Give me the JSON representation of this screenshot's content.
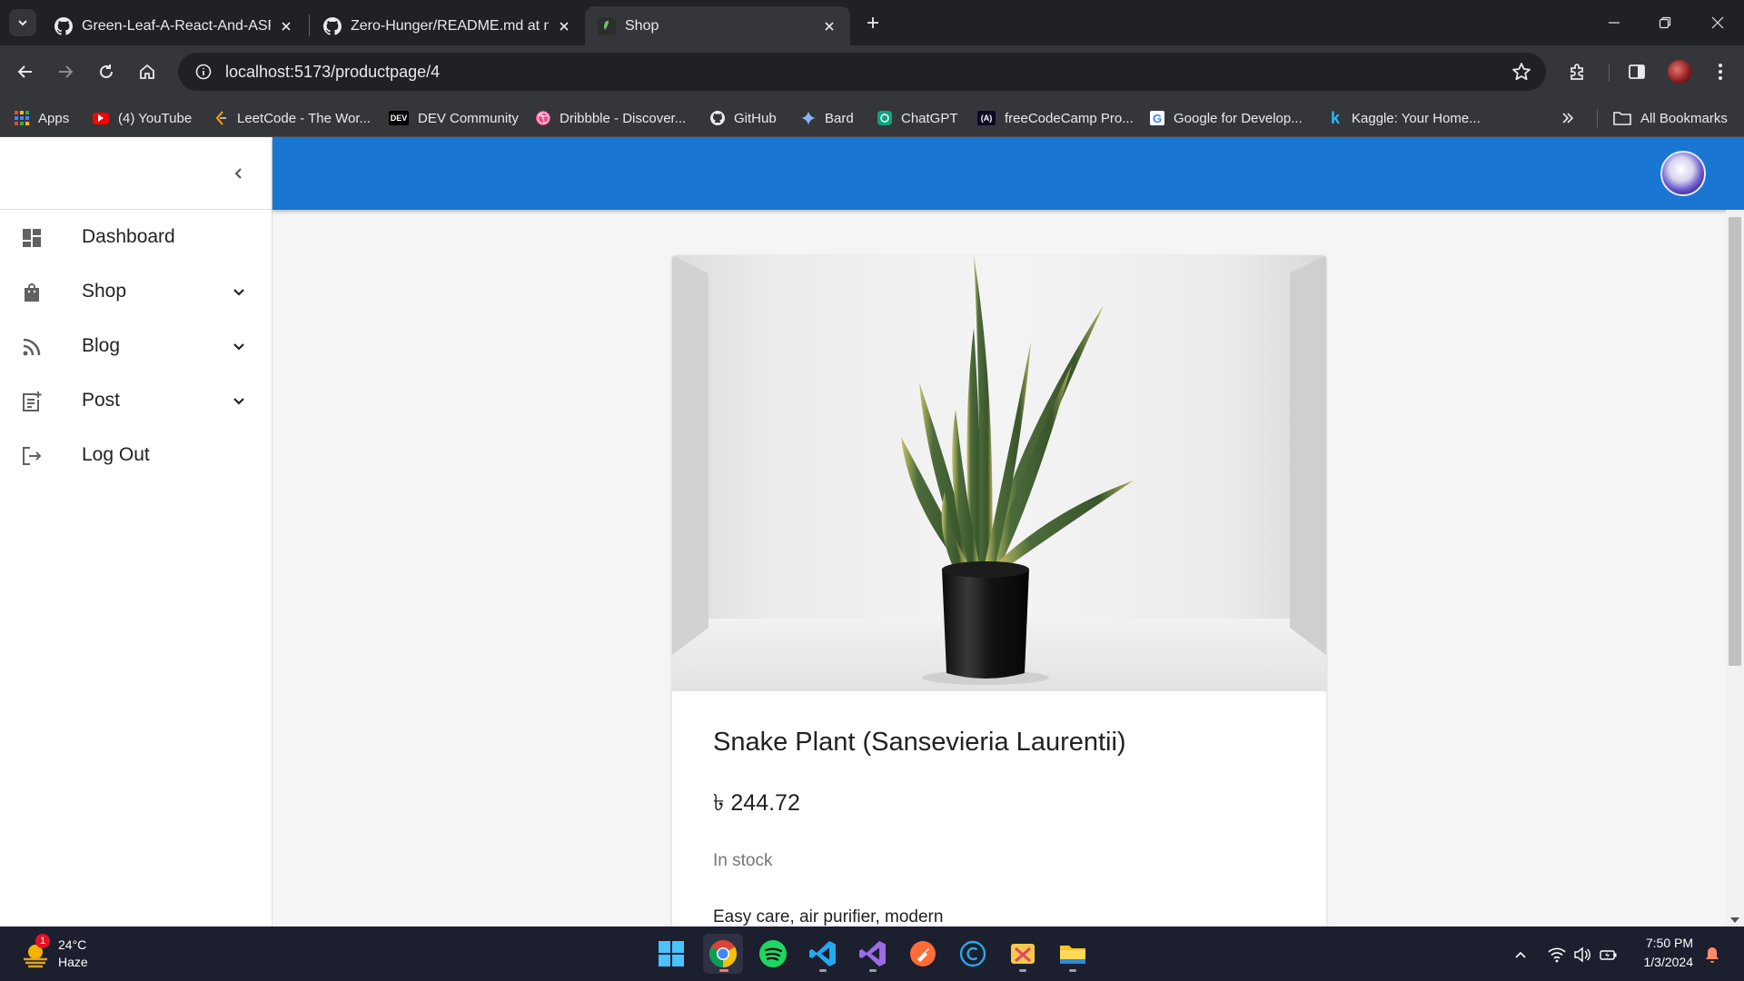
{
  "browser": {
    "tabs": [
      {
        "title": "Green-Leaf-A-React-And-ASP.N",
        "favicon": "github-icon"
      },
      {
        "title": "Zero-Hunger/README.md at m",
        "favicon": "github-icon"
      },
      {
        "title": "Shop",
        "favicon": "shop-favicon"
      }
    ],
    "url": "localhost:5173/productpage/4",
    "bookmarks": [
      {
        "label": "Apps"
      },
      {
        "label": "(4) YouTube"
      },
      {
        "label": "LeetCode - The Wor..."
      },
      {
        "label": "DEV Community"
      },
      {
        "label": "Dribbble - Discover..."
      },
      {
        "label": "GitHub"
      },
      {
        "label": "Bard"
      },
      {
        "label": "ChatGPT"
      },
      {
        "label": "freeCodeCamp Pro..."
      },
      {
        "label": "Google for Develop..."
      },
      {
        "label": "Kaggle: Your Home..."
      }
    ],
    "all_bookmarks_label": "All Bookmarks"
  },
  "sidebar": {
    "items": [
      {
        "label": "Dashboard",
        "icon": "dashboard-icon"
      },
      {
        "label": "Shop",
        "icon": "shopping-bag-icon"
      },
      {
        "label": "Blog",
        "icon": "rss-icon"
      },
      {
        "label": "Post",
        "icon": "post-add-icon"
      },
      {
        "label": "Log Out",
        "icon": "logout-icon"
      }
    ]
  },
  "product": {
    "title": "Snake Plant (Sansevieria Laurentii)",
    "price": "৳ 244.72",
    "stock": "In stock",
    "description": "Easy care, air purifier, modern"
  },
  "taskbar": {
    "temperature": "24°C",
    "condition": "Haze",
    "weather_badge": "1",
    "time": "7:50 PM",
    "date": "1/3/2024"
  },
  "colors": {
    "appbar": "#1976d2",
    "chrome_dark": "#202124",
    "chrome_toolbar": "#35363a",
    "taskbar": "#1c1f2e"
  }
}
